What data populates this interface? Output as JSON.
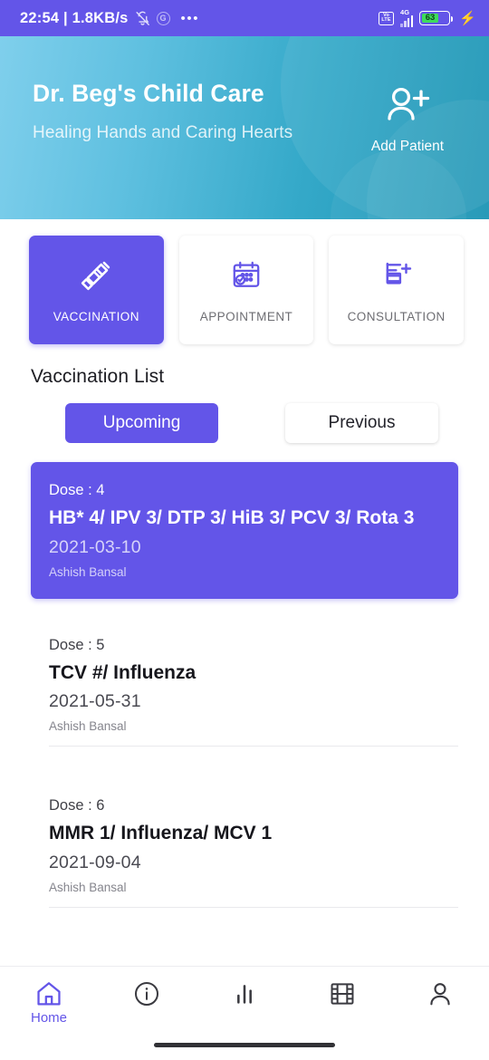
{
  "status_bar": {
    "clock_and_speed": "22:54 | 1.8KB/s",
    "silent_icon": "bell-muted-icon",
    "g_badge": "G",
    "overflow_dots": "•••",
    "volte_label_top": "Vo",
    "volte_label_bottom": "LTE",
    "network_type": "4G",
    "battery_percent": "63",
    "charging_icon": "⚡"
  },
  "header": {
    "clinic_name": "Dr. Beg's Child Care",
    "tagline": "Healing Hands and Caring Hearts",
    "add_patient_label": "Add Patient",
    "add_patient_icon": "person-plus-icon",
    "gradient_start": "#7FCFEC",
    "gradient_end": "#1B94B4"
  },
  "categories": [
    {
      "label": "VACCINATION",
      "icon": "syringe-icon",
      "active": true
    },
    {
      "label": "APPOINTMENT",
      "icon": "calendar-check-icon",
      "active": false
    },
    {
      "label": "CONSULTATION",
      "icon": "document-plus-icon",
      "active": false
    }
  ],
  "section": {
    "title": "Vaccination List",
    "tabs": [
      {
        "label": "Upcoming",
        "active": true
      },
      {
        "label": "Previous",
        "active": false
      }
    ]
  },
  "vaccination_list": [
    {
      "dose": "Dose : 4",
      "name": "HB* 4/ IPV 3/ DTP 3/ HiB 3/ PCV 3/ Rota 3",
      "date": "2021-03-10",
      "person": "Ashish Bansal",
      "highlighted": true
    },
    {
      "dose": "Dose : 5",
      "name": "TCV #/ Influenza",
      "date": "2021-05-31",
      "person": "Ashish Bansal",
      "highlighted": false
    },
    {
      "dose": "Dose : 6",
      "name": "MMR 1/ Influenza/ MCV 1",
      "date": "2021-09-04",
      "person": "Ashish Bansal",
      "highlighted": false
    }
  ],
  "bottom_nav": [
    {
      "label": "Home",
      "icon": "home-icon",
      "active": true
    },
    {
      "label": "",
      "icon": "info-icon",
      "active": false
    },
    {
      "label": "",
      "icon": "bar-chart-icon",
      "active": false
    },
    {
      "label": "",
      "icon": "film-icon",
      "active": false
    },
    {
      "label": "",
      "icon": "person-icon",
      "active": false
    }
  ],
  "theme": {
    "accent_purple": "#6355E8",
    "battery_green": "#3DDC5B"
  }
}
